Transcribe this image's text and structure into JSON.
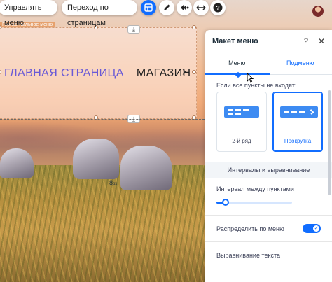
{
  "toolbar": {
    "manage_menu_label": "Управлять меню",
    "navigate_pages_label": "Переход по страницам",
    "layout_icon": "layout-icon",
    "design_icon": "pen-icon",
    "animation_icon": "animation-icon",
    "stretch_icon": "stretch-arrows-icon",
    "help_icon": "help-icon"
  },
  "canvas": {
    "strip_label": "Горизонтальное меню",
    "menu_items": [
      "ГЛАВНАЯ СТРАНИЦА",
      "МАГАЗИН"
    ],
    "next_arrow": "›",
    "download_glyph_top": "⤓",
    "download_glyph_bottom": "⤓"
  },
  "panel": {
    "title": "Макет меню",
    "help": "?",
    "close": "✕",
    "tabs": [
      {
        "label": "Меню",
        "active": true
      },
      {
        "label": "Подменю",
        "active": false
      }
    ],
    "fit_label": "Если все пункты не входят:",
    "options": [
      {
        "label": "2-й ряд",
        "selected": false
      },
      {
        "label": "Прокрутка",
        "selected": true
      }
    ],
    "spacing_section": "Интервалы и выравнивание",
    "spacing_label": "Интервал между пунктами",
    "spacing_value": "8",
    "spacing_unit": "px",
    "spacing_fraction": 0.12,
    "distribute_label": "Распределить по меню",
    "distribute_on": true,
    "toggle_check": "✓",
    "text_align_label": "Выравнивание текста"
  },
  "colors": {
    "accent": "#116dff",
    "menu_item_highlight": "#6a5ad6"
  }
}
